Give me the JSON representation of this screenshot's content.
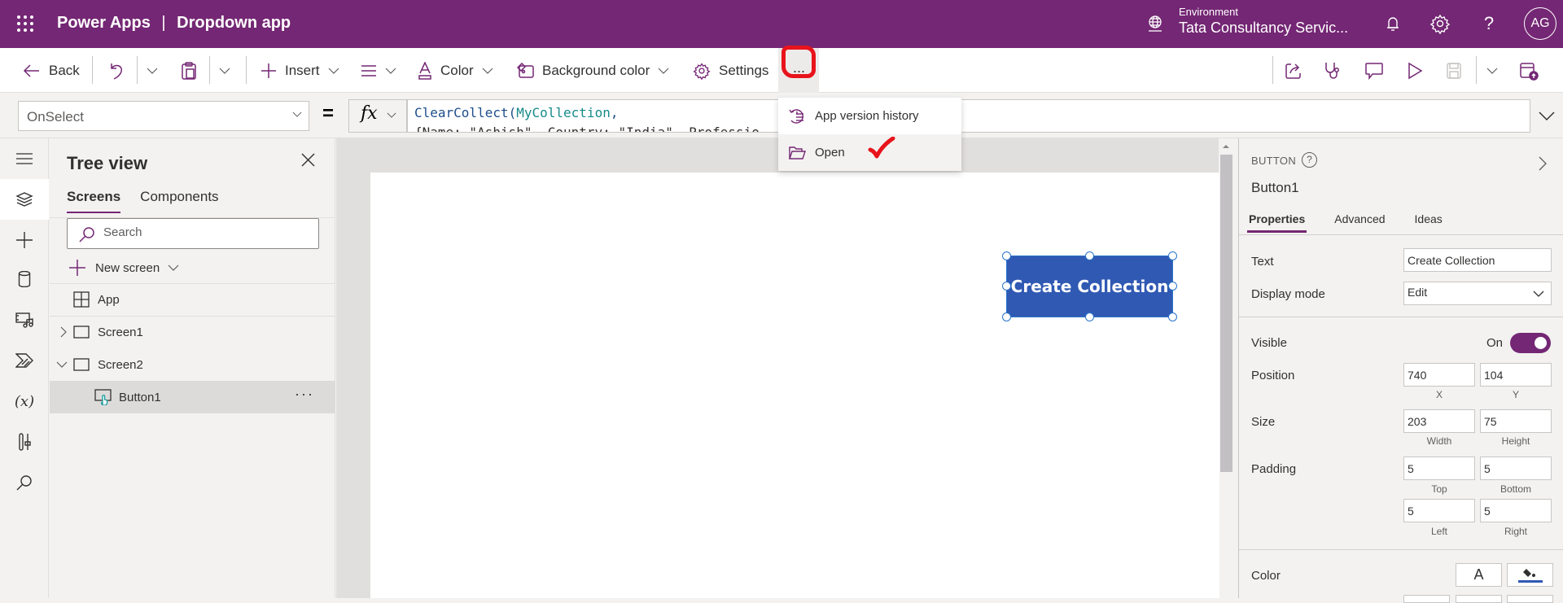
{
  "topbar": {
    "app_name": "Power Apps",
    "separator": "|",
    "document_title": "Dropdown app",
    "environment_label": "Environment",
    "environment_value": "Tata Consultancy Servic...",
    "avatar_initials": "AG",
    "icons": [
      "app-launcher-icon",
      "environment-icon",
      "notification-bell-icon",
      "settings-gear-icon",
      "help-icon"
    ]
  },
  "commandbar": {
    "back_label": "Back",
    "insert_label": "Insert",
    "color_label": "Color",
    "background_color_label": "Background color",
    "settings_label": "Settings",
    "more_label": "...",
    "right_icons": [
      "share-icon",
      "app-checker-icon",
      "comments-icon",
      "preview-play-icon",
      "save-icon",
      "publish-icon"
    ]
  },
  "overflow_menu": {
    "items": [
      {
        "label": "App version history",
        "icon": "version-history-icon"
      },
      {
        "label": "Open",
        "icon": "folder-open-icon"
      }
    ]
  },
  "formulabar": {
    "property": "OnSelect",
    "equals": "=",
    "fx_label": "fx",
    "formula_fn": "ClearCollect(",
    "formula_collection": "MyCollection",
    "formula_line1_tail": ",",
    "formula_line2": "{Name: \"Ashish\", Country: \"India\", Professio"
  },
  "leftrail": {
    "items": [
      "hamburger-menu",
      "tree-view",
      "insert",
      "data",
      "media",
      "power-automate",
      "variables",
      "advanced-tools",
      "search"
    ]
  },
  "treeview": {
    "title": "Tree view",
    "tabs": [
      {
        "label": "Screens",
        "active": true
      },
      {
        "label": "Components",
        "active": false
      }
    ],
    "search_placeholder": "Search",
    "search_value": "",
    "new_screen_label": "New screen",
    "nodes": [
      {
        "label": "App",
        "type": "app",
        "expanded": null
      },
      {
        "label": "Screen1",
        "type": "screen",
        "expanded": false
      },
      {
        "label": "Screen2",
        "type": "screen",
        "expanded": true
      },
      {
        "label": "Button1",
        "type": "button",
        "selected": true,
        "more": "···"
      }
    ]
  },
  "canvas": {
    "button_text": "Create Collection",
    "button_color": "#3059b3"
  },
  "properties": {
    "control_type": "BUTTON",
    "help_glyph": "?",
    "control_name": "Button1",
    "tabs": [
      {
        "label": "Properties",
        "active": true
      },
      {
        "label": "Advanced",
        "active": false
      },
      {
        "label": "Ideas",
        "active": false
      }
    ],
    "text_label": "Text",
    "text_value": "Create Collection",
    "display_mode_label": "Display mode",
    "display_mode_value": "Edit",
    "visible_label": "Visible",
    "visible_state": "On",
    "visible_on": true,
    "position_label": "Position",
    "position_x": "740",
    "position_y": "104",
    "x_label": "X",
    "y_label": "Y",
    "size_label": "Size",
    "width": "203",
    "height": "75",
    "width_label": "Width",
    "height_label": "Height",
    "padding_label": "Padding",
    "padding_top": "5",
    "padding_bottom": "5",
    "padding_left": "5",
    "padding_right": "5",
    "top_label": "Top",
    "bottom_label": "Bottom",
    "left_label": "Left",
    "right_label": "Right",
    "color_label": "Color",
    "text_color_glyph": "A",
    "fill_color": "#3059b3"
  },
  "colors": {
    "brand": "#742774",
    "selection": "#2a74c9",
    "annotation_red": "#e8141b"
  }
}
